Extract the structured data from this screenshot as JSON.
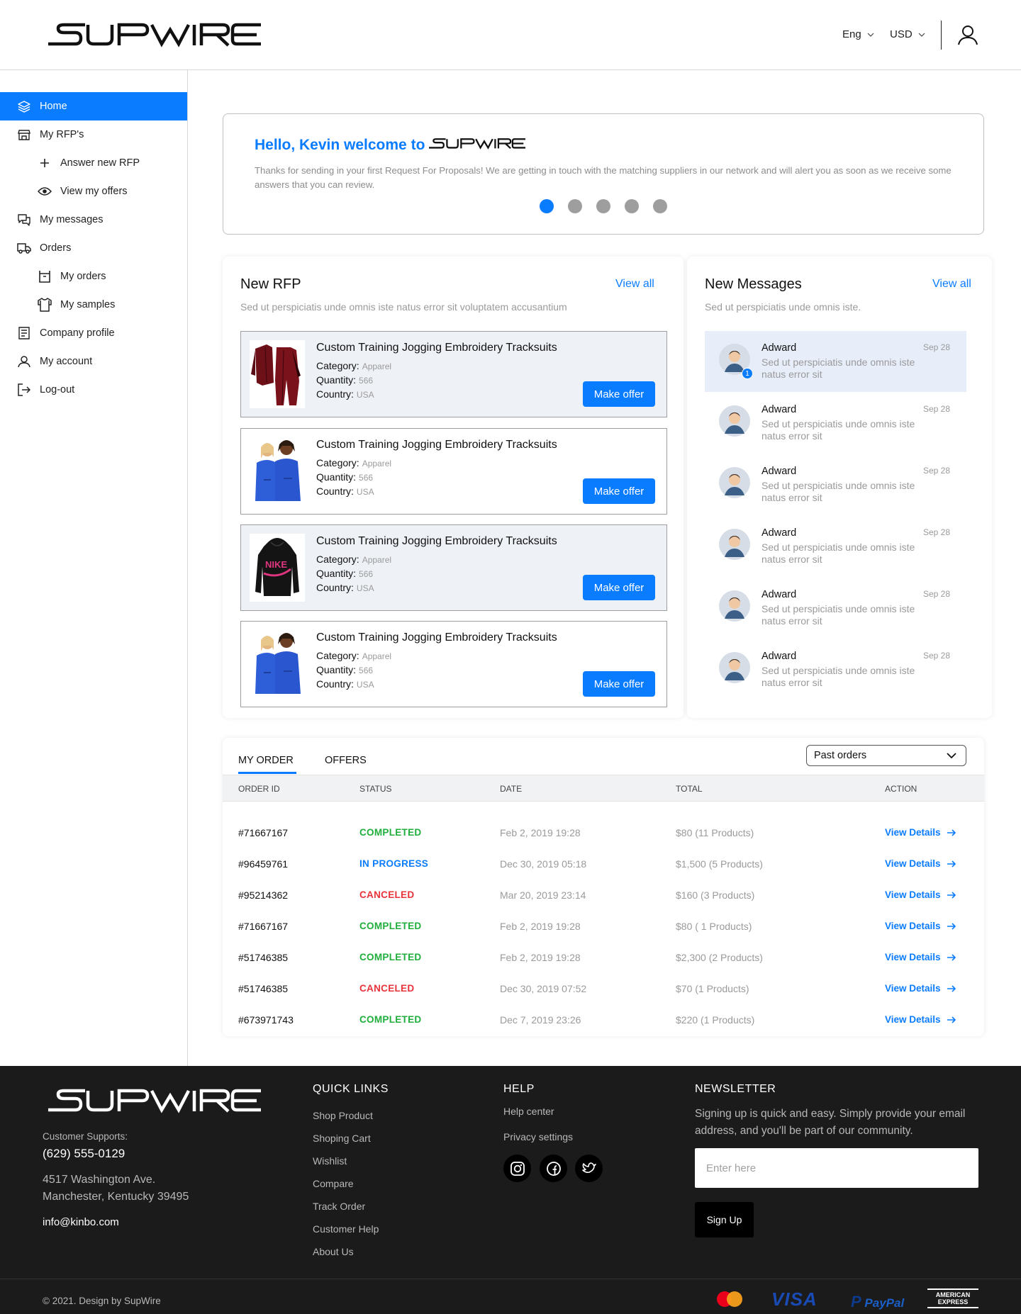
{
  "header": {
    "brand": "SUPWIRE",
    "language": "Eng",
    "currency": "USD"
  },
  "sidebar": {
    "items": [
      {
        "label": "Home",
        "icon": "layers-icon"
      },
      {
        "label": "My RFP's",
        "icon": "store-icon"
      },
      {
        "label": "Answer new RFP",
        "icon": "plus-icon"
      },
      {
        "label": "View my offers",
        "icon": "eye-icon"
      },
      {
        "label": "My messages",
        "icon": "chat-icon"
      },
      {
        "label": "Orders",
        "icon": "truck-icon"
      },
      {
        "label": "My orders",
        "icon": "box-icon"
      },
      {
        "label": "My samples",
        "icon": "shirt-icon"
      },
      {
        "label": "Company profile",
        "icon": "document-icon"
      },
      {
        "label": "My account",
        "icon": "user-icon"
      },
      {
        "label": "Log-out",
        "icon": "logout-icon"
      }
    ]
  },
  "welcome": {
    "title": "Hello, Kevin welcome to",
    "text": "Thanks for sending in your first Request For Proposals! We are getting in touch with the matching suppliers in our network and will alert you as soon as we receive some answers that you can review.",
    "slides": 5,
    "active_slide": 1
  },
  "rfp": {
    "title": "New RFP",
    "view_all": "View all",
    "subtitle": "Sed ut perspiciatis unde omnis iste natus error sit voluptatem accusantium",
    "category_label": "Category:",
    "quantity_label": "Quantity:",
    "country_label": "Country:",
    "button_label": "Make offer",
    "items": [
      {
        "name": "Custom Training Jogging Embroidery Tracksuits",
        "category": "Apparel",
        "quantity": "566",
        "country": "USA"
      },
      {
        "name": "Custom Training Jogging Embroidery Tracksuits",
        "category": "Apparel",
        "quantity": "566",
        "country": "USA"
      },
      {
        "name": "Custom Training Jogging Embroidery Tracksuits",
        "category": "Apparel",
        "quantity": "566",
        "country": "USA"
      },
      {
        "name": "Custom Training Jogging Embroidery Tracksuits",
        "category": "Apparel",
        "quantity": "566",
        "country": "USA"
      }
    ]
  },
  "messages": {
    "title": "New Messages",
    "view_all": "View all",
    "subtitle": "Sed ut perspiciatis unde omnis iste.",
    "items": [
      {
        "name": "Adward",
        "date": "Sep 28",
        "text": "Sed ut perspiciatis unde omnis iste natus error sit",
        "badge": "1"
      },
      {
        "name": "Adward",
        "date": "Sep 28",
        "text": "Sed ut perspiciatis unde omnis iste natus error sit"
      },
      {
        "name": "Adward",
        "date": "Sep 28",
        "text": "Sed ut perspiciatis unde omnis iste natus error sit"
      },
      {
        "name": "Adward",
        "date": "Sep 28",
        "text": "Sed ut perspiciatis unde omnis iste natus error sit"
      },
      {
        "name": "Adward",
        "date": "Sep 28",
        "text": "Sed ut perspiciatis unde omnis iste natus error sit"
      },
      {
        "name": "Adward",
        "date": "Sep 28",
        "text": "Sed ut perspiciatis unde omnis iste natus error sit"
      }
    ]
  },
  "orders": {
    "tabs": [
      "MY ORDER",
      "OFFERS"
    ],
    "filter": "Past orders",
    "columns": [
      "ORDER ID",
      "STATUS",
      "DATE",
      "TOTAL",
      "ACTION"
    ],
    "action_label": "View Details",
    "status_colors": {
      "COMPLETED": "#1fae3b",
      "IN PROGRESS": "#0a7cff",
      "CANCELED": "#e8333a"
    },
    "rows": [
      {
        "id": "#71667167",
        "status": "COMPLETED",
        "date": "Feb 2, 2019 19:28",
        "total": "$80 (11 Products)"
      },
      {
        "id": "#96459761",
        "status": "IN PROGRESS",
        "date": "Dec 30, 2019 05:18",
        "total": "$1,500 (5 Products)"
      },
      {
        "id": "#95214362",
        "status": "CANCELED",
        "date": "Mar 20, 2019 23:14",
        "total": "$160 (3 Products)"
      },
      {
        "id": "#71667167",
        "status": "COMPLETED",
        "date": "Feb 2, 2019 19:28",
        "total": "$80 ( 1 Products)"
      },
      {
        "id": "#51746385",
        "status": "COMPLETED",
        "date": "Feb 2, 2019 19:28",
        "total": "$2,300 (2 Products)"
      },
      {
        "id": "#51746385",
        "status": "CANCELED",
        "date": "Dec 30, 2019 07:52",
        "total": "$70 (1 Products)"
      },
      {
        "id": "#673971743",
        "status": "COMPLETED",
        "date": "Dec 7, 2019 23:26",
        "total": "$220 (1 Products)"
      }
    ]
  },
  "footer": {
    "support_label": "Customer Supports:",
    "phone": "(629) 555-0129",
    "address_line1": "4517 Washington Ave.",
    "address_line2": "Manchester, Kentucky 39495",
    "email": "info@kinbo.com",
    "quick_links_title": "QUICK LINKS",
    "quick_links": [
      "Shop Product",
      "Shoping Cart",
      "Wishlist",
      "Compare",
      "Track Order",
      "Customer Help",
      "About Us"
    ],
    "help_title": "HELP",
    "help_links": [
      "Help center",
      "Privacy settings"
    ],
    "newsletter_title": "NEWSLETTER",
    "newsletter_text": "Signing up is quick and easy. Simply provide your email address, and you'll be part of our community.",
    "newsletter_placeholder": "Enter here",
    "signup_label": "Sign Up",
    "copyright": "© 2021. Design by SupWire",
    "payments": [
      "mastercard-icon",
      "VISA",
      "PayPal",
      "AMERICAN EXPRESS"
    ]
  }
}
